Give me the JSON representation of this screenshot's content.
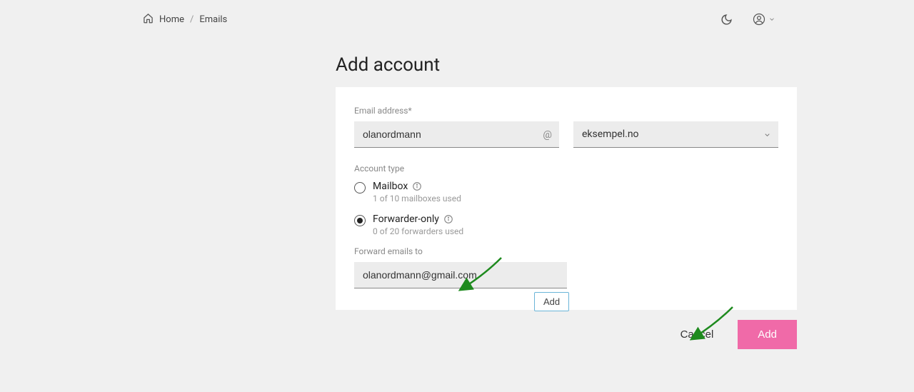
{
  "breadcrumb": {
    "home": "Home",
    "emails": "Emails"
  },
  "page_title": "Add account",
  "form": {
    "email_label": "Email address*",
    "email_value": "olanordmann",
    "at_symbol": "@",
    "domain_selected": "eksempel.no",
    "account_type_label": "Account type",
    "options": {
      "mailbox": {
        "title": "Mailbox",
        "sub": "1 of 10 mailboxes used"
      },
      "forwarder": {
        "title": "Forwarder-only",
        "sub": "0 of 20 forwarders used"
      }
    },
    "forward_label": "Forward emails to",
    "forward_value": "olanordmann@gmail.com",
    "add_small": "Add"
  },
  "footer": {
    "cancel": "Cancel",
    "add": "Add"
  }
}
